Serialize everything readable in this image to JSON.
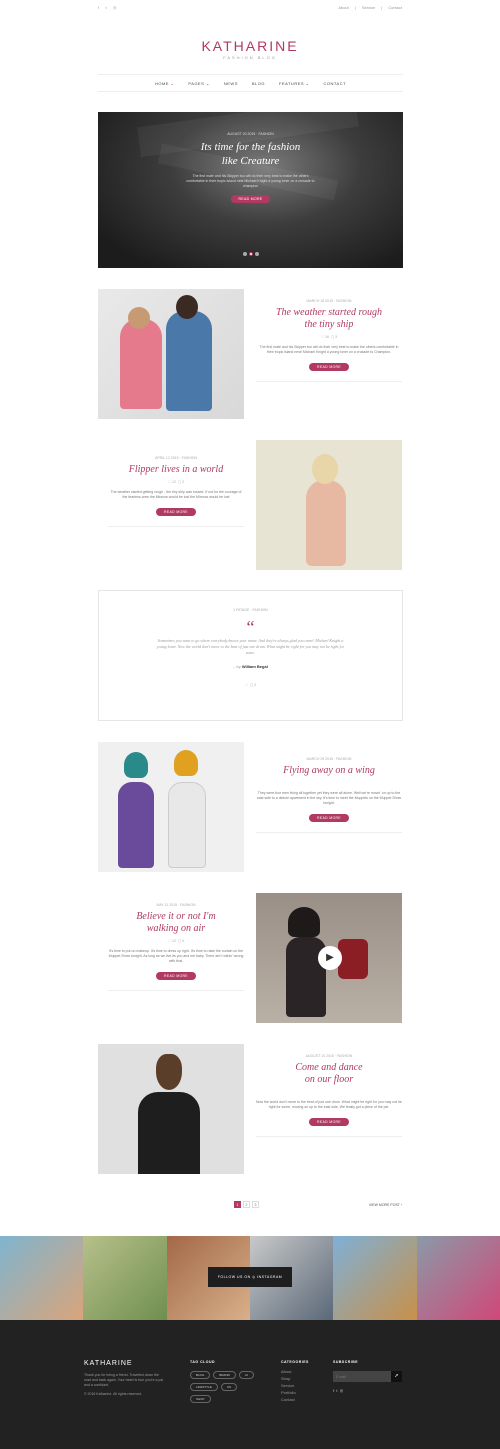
{
  "topbar": {
    "social_icons": [
      "facebook-icon",
      "twitter-icon",
      "instagram-icon"
    ],
    "links": [
      "About",
      "Service",
      "Contact"
    ]
  },
  "brand": {
    "name": "KATHARINE",
    "tagline": "FASHION BLOG",
    "accent": "#b03a62"
  },
  "nav": [
    {
      "label": "HOME"
    },
    {
      "label": "PAGES"
    },
    {
      "label": "NEWS"
    },
    {
      "label": "BLOG"
    },
    {
      "label": "FEATURES"
    },
    {
      "label": "CONTACT"
    }
  ],
  "hero": {
    "meta": "AUGUST 20 2015 · FASHION",
    "title_line1": "Its time for the fashion",
    "title_line2": "like Creature",
    "text": "The first mate and his Skipper too will do their very best to make the others comfortable in their tropic island nest Michael Knight a young loner on a crusade to champion",
    "button": "READ MORE"
  },
  "posts": [
    {
      "meta": "MARCH 16 2015 · FASHION",
      "title_line1": "The weather started rough",
      "title_line2": "the tiny ship",
      "likes": "16",
      "comments": "3",
      "excerpt": "The first mate and his Skipper too will do their very best to make the others comfortable in their tropic island nest! Michael Knight a young loner on a crusade to Champion.",
      "button": "READ MORE"
    },
    {
      "meta": "APRIL 12 2015 · FASHION",
      "title_line1": "Flipper lives in a world",
      "title_line2": "",
      "likes": "12",
      "comments": "2",
      "excerpt": "The weather started getting rough - the tiny ship was tossed. If not for the courage of the fearless crew the Minnow would be lost the Minnow would be lost",
      "button": "READ MORE"
    },
    {
      "meta": "MARCH 29 2015 · FASHION",
      "title_line1": "Flying away on a wing",
      "title_line2": "",
      "likes": "",
      "comments": "",
      "excerpt": "They were four men living all together yet they were all alone. Well we're movin' on up to the east side to a deluxe apartment in the sky. It's time to meet the Muppets on the Muppet Show tonight.",
      "button": "READ MORE"
    },
    {
      "meta": "MAY 11 2015 · FASHION",
      "title_line1": "Believe it or not I'm",
      "title_line2": "walking on air",
      "likes": "12",
      "comments": "0",
      "excerpt": "It's time to put on makeup. It's time to dress up right. It's time to raise the curtain on the Muppet Show tonight. As long as we live its you and me baby. There ain't nothin' wrong with that.",
      "button": "READ MORE"
    },
    {
      "meta": "AUGUST 10 2015 · FASHION",
      "title_line1": "Come and dance",
      "title_line2": "on our floor",
      "likes": "",
      "comments": "",
      "excerpt": "Now the world don't move to the beat of just one drum. What might be right for you may not be right for some, moving on up to the east side. We finally got a piece of the pie.",
      "button": "READ MORE"
    }
  ],
  "quote": {
    "meta": "1 FATAGE · FASHION",
    "text": "Sometimes you want to go where everybody knows your name, And they're always glad you came! Michael Knight a young loner. Now the world don't move to the beat of just one drum. What might be right for you may not be right for some.",
    "author_prefix": "– by",
    "author": "William Begal",
    "likes": "",
    "comments": "2"
  },
  "pagination": {
    "pages": [
      "1",
      "2",
      "3"
    ],
    "next": "VIEW MORE POST"
  },
  "instagram": {
    "label": "FOLLOW US ON",
    "brand": "INSTAGRAM"
  },
  "footer": {
    "brand": "KATHARINE",
    "about": "Thank you for being a friend. Travelled down the road and back again. Your heart is true you're a pal and a confidant.",
    "copyright": "© 2016 Katharine. All rights reserved.",
    "tag_cloud_title": "TAG CLOUD",
    "tags": [
      "BLOG",
      "BRAND",
      "UI",
      "LIFESTYLE",
      "CS",
      "SHOP"
    ],
    "categories_title": "CATEGORIES",
    "categories": [
      "About",
      "Shop",
      "Service",
      "Portfolio",
      "Contact"
    ],
    "subscribe_title": "SUBSCRIBE",
    "email_placeholder": "E-mail"
  }
}
